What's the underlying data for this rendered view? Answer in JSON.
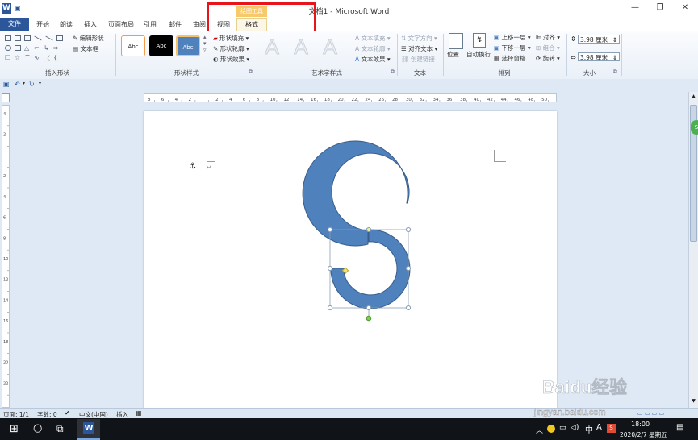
{
  "window": {
    "title": "文档1 - Microsoft Word",
    "min_glyph": "—",
    "max_glyph": "❐",
    "close_glyph": "✕",
    "app_icon_letter": "W"
  },
  "tabs": {
    "file": "文件",
    "items": [
      "开始",
      "朗读",
      "插入",
      "页面布局",
      "引用",
      "邮件",
      "审阅",
      "视图"
    ],
    "context_group": "绘图工具",
    "format": "格式"
  },
  "ribbon": {
    "insert_shapes": {
      "label": "插入形状",
      "edit_shape": "编辑形状",
      "text_box": "文本框"
    },
    "shape_styles": {
      "label": "形状样式",
      "preset_label": "Abc",
      "fill": "形状填充",
      "outline": "形状轮廓",
      "effects": "形状效果"
    },
    "wordart": {
      "label": "艺术字样式",
      "letter": "A",
      "text_fill": "文本填充",
      "text_outline": "文本轮廓",
      "text_effects": "文本效果"
    },
    "text": {
      "label": "文本",
      "direction": "文字方向",
      "align": "对齐文本",
      "link": "创建链接"
    },
    "arrange": {
      "label": "排列",
      "position": "位置",
      "wrap": "自动换行",
      "bring_forward": "上移一层",
      "send_backward": "下移一层",
      "selection_pane": "选择窗格",
      "align": "对齐",
      "group": "组合",
      "rotate": "旋转"
    },
    "size": {
      "label": "大小",
      "height": "3.98 厘米",
      "width": "3.98 厘米"
    }
  },
  "ruler": {
    "h_ticks": [
      "8",
      "6",
      "4",
      "2",
      "",
      "2",
      "4",
      "6",
      "8",
      "10",
      "12",
      "14",
      "16",
      "18",
      "20",
      "22",
      "24",
      "26",
      "28",
      "30",
      "32",
      "34",
      "36",
      "38",
      "40",
      "42",
      "44",
      "46",
      "48",
      "50"
    ],
    "v_ticks": [
      "4",
      "2",
      "",
      "2",
      "4",
      "6",
      "8",
      "10",
      "12",
      "14",
      "16",
      "18",
      "20",
      "22"
    ]
  },
  "document": {
    "anchor_glyph": "⚓",
    "para_mark": "↵"
  },
  "colors": {
    "shape_fill": "#4f81bd",
    "shape_stroke": "#385d8a",
    "file_tab": "#2b579a",
    "highlight_box": "#e8141b",
    "context_tab": "#f7c96b"
  },
  "status": {
    "page": "页面: 1/1",
    "words": "字数: 0",
    "language": "中文(中国)",
    "mode": "插入"
  },
  "taskbar": {
    "time": "18:00",
    "date": "2020/2/7 星期五",
    "ime": "中",
    "a_glyph": "A"
  },
  "watermark": {
    "logo": "Baidu经验",
    "url": "jingyan.baidu.com"
  }
}
